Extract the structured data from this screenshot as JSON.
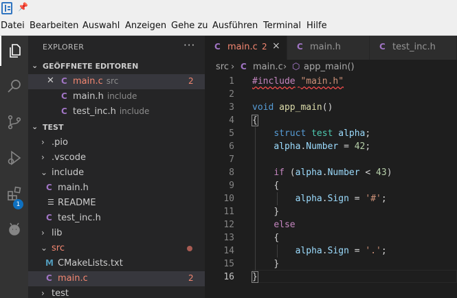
{
  "menubar": {
    "items": [
      "Datei",
      "Bearbeiten",
      "Auswahl",
      "Anzeigen",
      "Gehe zu",
      "Ausführen",
      "Terminal",
      "Hilfe"
    ]
  },
  "activity_bar": {
    "items": [
      "explorer-icon",
      "search-icon",
      "source-control-icon",
      "run-debug-icon",
      "extensions-icon",
      "platformio-icon"
    ],
    "extensions_badge": "1"
  },
  "sidebar": {
    "title": "EXPLORER",
    "more": "···",
    "open_editors": {
      "header": "GEÖFFNETE EDITOREN",
      "items": [
        {
          "icon": "C",
          "name": "main.c",
          "desc": "src",
          "count": "2"
        },
        {
          "icon": "C",
          "name": "main.h",
          "desc": "include",
          "count": ""
        },
        {
          "icon": "C",
          "name": "test_inc.h",
          "desc": "include",
          "count": ""
        }
      ]
    },
    "workspace": {
      "header": "TEST",
      "items": [
        {
          "name": ".pio"
        },
        {
          "name": ".vscode"
        },
        {
          "name": "include"
        },
        {
          "name": "main.h"
        },
        {
          "name": "README"
        },
        {
          "name": "test_inc.h"
        },
        {
          "name": "lib"
        },
        {
          "name": "src"
        },
        {
          "name": "CMakeLists.txt"
        },
        {
          "name": "main.c",
          "count": "2"
        },
        {
          "name": "test"
        }
      ]
    }
  },
  "tabs": [
    {
      "icon": "C",
      "label": "main.c",
      "count": "2",
      "close": "×"
    },
    {
      "icon": "C",
      "label": "main.h"
    },
    {
      "icon": "C",
      "label": "test_inc.h"
    }
  ],
  "breadcrumb": {
    "folder": "src",
    "file_icon": "C",
    "file": "main.c",
    "symbol": "app_main()"
  },
  "editor": {
    "line_numbers": [
      "1",
      "2",
      "3",
      "4",
      "5",
      "6",
      "7",
      "8",
      "9",
      "10",
      "11",
      "12",
      "13",
      "14",
      "15",
      "16"
    ],
    "lines": {
      "l1_directive": "#include",
      "l1_str": "\"main.h\"",
      "l3_type": "void",
      "l3_fn": "app_main",
      "l3_paren": "()",
      "l4_brace": "{",
      "l5_kw": "struct",
      "l5_cls": "test",
      "l5_var": "alpha",
      "l5_semi": ";",
      "l6_var": "alpha",
      "l6_dot": ".",
      "l6_field": "Number",
      "l6_eq": " = ",
      "l6_num": "42",
      "l6_semi": ";",
      "l8_kw": "if",
      "l8_open": " (",
      "l8_var": "alpha",
      "l8_dot": ".",
      "l8_field": "Number",
      "l8_lt": " < ",
      "l8_num": "43",
      "l8_close": ")",
      "l9_brace": "{",
      "l10_var": "alpha",
      "l10_dot": ".",
      "l10_field": "Sign",
      "l10_eq": " = ",
      "l10_str": "'#'",
      "l10_semi": ";",
      "l11_brace": "}",
      "l12_kw": "else",
      "l13_brace": "{",
      "l14_var": "alpha",
      "l14_dot": ".",
      "l14_field": "Sign",
      "l14_eq": " = ",
      "l14_str": "'.'",
      "l14_semi": ";",
      "l15_brace": "}",
      "l16_brace": "}"
    }
  }
}
